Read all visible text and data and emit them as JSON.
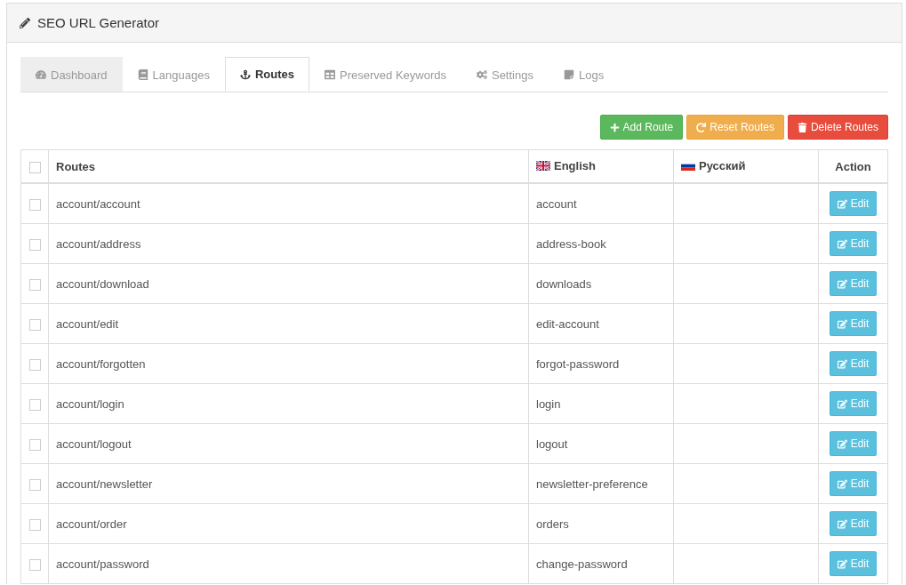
{
  "panel": {
    "title": "SEO URL Generator"
  },
  "tabs": [
    {
      "label": "Dashboard",
      "selected": false,
      "hovered": true
    },
    {
      "label": "Languages",
      "selected": false,
      "hovered": false
    },
    {
      "label": "Routes",
      "selected": true,
      "hovered": false
    },
    {
      "label": "Preserved Keywords",
      "selected": false,
      "hovered": false
    },
    {
      "label": "Settings",
      "selected": false,
      "hovered": false
    },
    {
      "label": "Logs",
      "selected": false,
      "hovered": false
    }
  ],
  "buttons": [
    {
      "label": "Add Route",
      "kind": "add"
    },
    {
      "label": "Reset Routes",
      "kind": "reset"
    },
    {
      "label": "Delete Routes",
      "kind": "delete"
    }
  ],
  "table": {
    "select_all": {
      "checked": false
    },
    "columns": [
      {
        "label": "Routes",
        "kind": "text"
      },
      {
        "label": "English",
        "kind": "language"
      },
      {
        "label": "Русский",
        "kind": "language"
      },
      {
        "label": "Action",
        "kind": "action"
      }
    ],
    "rows": [
      {
        "checked": false,
        "route": "account/account",
        "english": "account",
        "russian": "",
        "action": "Edit"
      },
      {
        "checked": false,
        "route": "account/address",
        "english": "address-book",
        "russian": "",
        "action": "Edit"
      },
      {
        "checked": false,
        "route": "account/download",
        "english": "downloads",
        "russian": "",
        "action": "Edit"
      },
      {
        "checked": false,
        "route": "account/edit",
        "english": "edit-account",
        "russian": "",
        "action": "Edit"
      },
      {
        "checked": false,
        "route": "account/forgotten",
        "english": "forgot-password",
        "russian": "",
        "action": "Edit"
      },
      {
        "checked": false,
        "route": "account/login",
        "english": "login",
        "russian": "",
        "action": "Edit"
      },
      {
        "checked": false,
        "route": "account/logout",
        "english": "logout",
        "russian": "",
        "action": "Edit"
      },
      {
        "checked": false,
        "route": "account/newsletter",
        "english": "newsletter-preference",
        "russian": "",
        "action": "Edit"
      },
      {
        "checked": false,
        "route": "account/order",
        "english": "orders",
        "russian": "",
        "action": "Edit"
      },
      {
        "checked": false,
        "route": "account/password",
        "english": "change-password",
        "russian": "",
        "action": "Edit"
      }
    ]
  }
}
